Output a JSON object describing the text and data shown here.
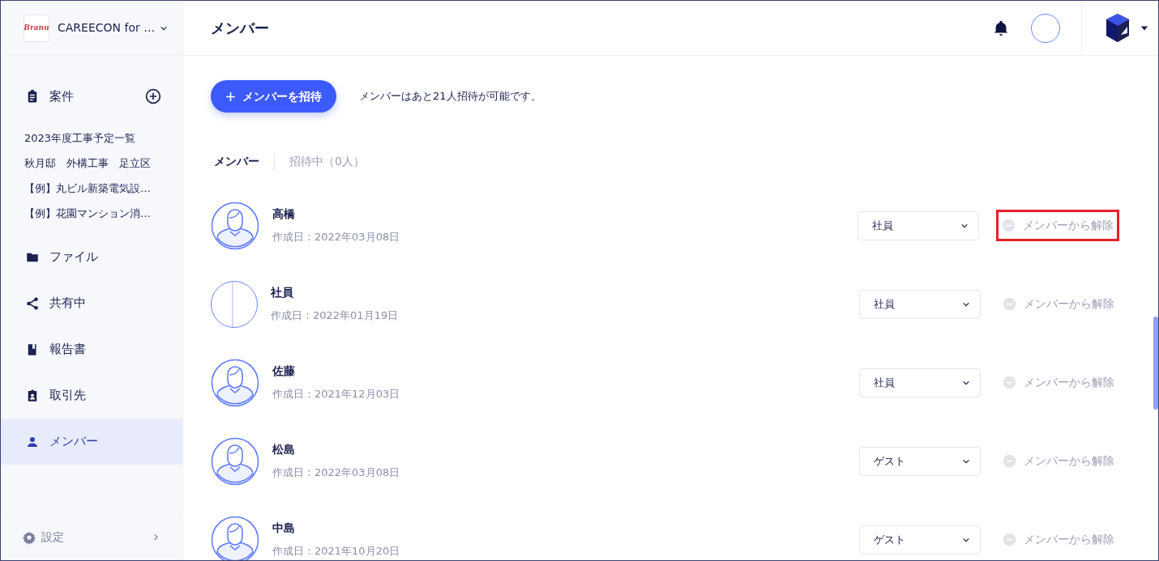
{
  "sidebar": {
    "org": {
      "logo_text": "Branu",
      "name": "CAREECON for …"
    },
    "sections": [
      {
        "kind": "projects",
        "label": "案件"
      },
      {
        "kind": "nav",
        "label": "ファイル",
        "selected": false
      },
      {
        "kind": "nav",
        "label": "共有中",
        "selected": false
      },
      {
        "kind": "nav",
        "label": "報告書",
        "selected": false
      },
      {
        "kind": "nav",
        "label": "取引先",
        "selected": false
      },
      {
        "kind": "nav",
        "label": "メンバー",
        "selected": true
      }
    ],
    "projects": [
      "2023年度工事予定一覧",
      "秋月邸　外構工事　足立区",
      "【例】丸ビル新築電気設…",
      "【例】花園マンション消…"
    ],
    "settings": "設定"
  },
  "header": {
    "title": "メンバー"
  },
  "invite": {
    "button": "メンバーを招待",
    "note": "メンバーはあと21人招待が可能です。"
  },
  "tabs": [
    {
      "label": "メンバー",
      "selected": true
    },
    {
      "label": "招待中（0人）",
      "selected": false
    }
  ],
  "members": [
    {
      "name": "高橋",
      "created": "作成日：2022年03月08日",
      "kind": "default",
      "role": "社員",
      "remove": "メンバーから解除",
      "highlighted": true
    },
    {
      "name": "社員",
      "created": "作成日：2022年01月19日",
      "kind": "photo",
      "role": "社員",
      "remove": "メンバーから解除",
      "highlighted": false
    },
    {
      "name": "佐藤",
      "created": "作成日：2021年12月03日",
      "kind": "default",
      "role": "社員",
      "remove": "メンバーから解除",
      "highlighted": false
    },
    {
      "name": "松島",
      "created": "作成日：2022年03月08日",
      "kind": "default",
      "role": "ゲスト",
      "remove": "メンバーから解除",
      "highlighted": false
    },
    {
      "name": "中島",
      "created": "作成日：2021年10月20日",
      "kind": "default",
      "role": "ゲスト",
      "remove": "メンバーから解除",
      "highlighted": false
    }
  ]
}
